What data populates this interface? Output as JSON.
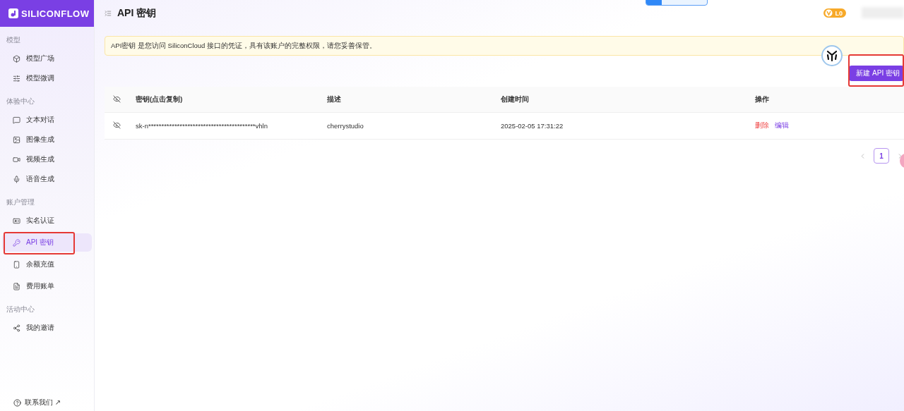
{
  "brand": {
    "name": "SILICONFLOW"
  },
  "header": {
    "title": "API 密钥",
    "level_badge": "L0",
    "top_bar": {
      "level": 0.25
    }
  },
  "sidebar": {
    "groups": [
      {
        "title": "模型",
        "items": [
          {
            "label": "模型广场",
            "selected": false,
            "highlighted": false
          },
          {
            "label": "模型微调",
            "selected": false,
            "highlighted": false
          }
        ]
      },
      {
        "title": "体验中心",
        "items": [
          {
            "label": "文本对话",
            "selected": false,
            "highlighted": false
          },
          {
            "label": "图像生成",
            "selected": false,
            "highlighted": false
          },
          {
            "label": "视频生成",
            "selected": false,
            "highlighted": false
          },
          {
            "label": "语音生成",
            "selected": false,
            "highlighted": false
          }
        ]
      },
      {
        "title": "账户管理",
        "items": [
          {
            "label": "实名认证",
            "selected": false,
            "highlighted": false
          },
          {
            "label": "API 密钥",
            "selected": true,
            "highlighted": true
          },
          {
            "label": "余额充值",
            "selected": false,
            "highlighted": false
          },
          {
            "label": "费用账单",
            "selected": false,
            "highlighted": false
          }
        ]
      },
      {
        "title": "活动中心",
        "items": [
          {
            "label": "我的邀请",
            "selected": false,
            "highlighted": false
          }
        ]
      }
    ],
    "footer_link": "联系我们 ↗"
  },
  "notice": "API密钥 是您访问 SiliconCloud 接口的凭证，具有该账户的完整权限，请您妥善保管。",
  "new_key_button": {
    "label": "新建 API 密钥",
    "highlighted": true
  },
  "table": {
    "columns": [
      "密钥(点击复制)",
      "描述",
      "创建时间",
      "操作"
    ],
    "rows": [
      {
        "key": "sk-n*****************************************vhln",
        "description": "cherrystudio",
        "created": "2025-02-05 17:31:22",
        "actions": [
          {
            "label": "删除",
            "kind": "danger"
          },
          {
            "label": "编辑",
            "kind": "normal"
          }
        ]
      }
    ]
  },
  "pagination": {
    "pages": [
      {
        "label": "1",
        "selected": true
      }
    ]
  }
}
